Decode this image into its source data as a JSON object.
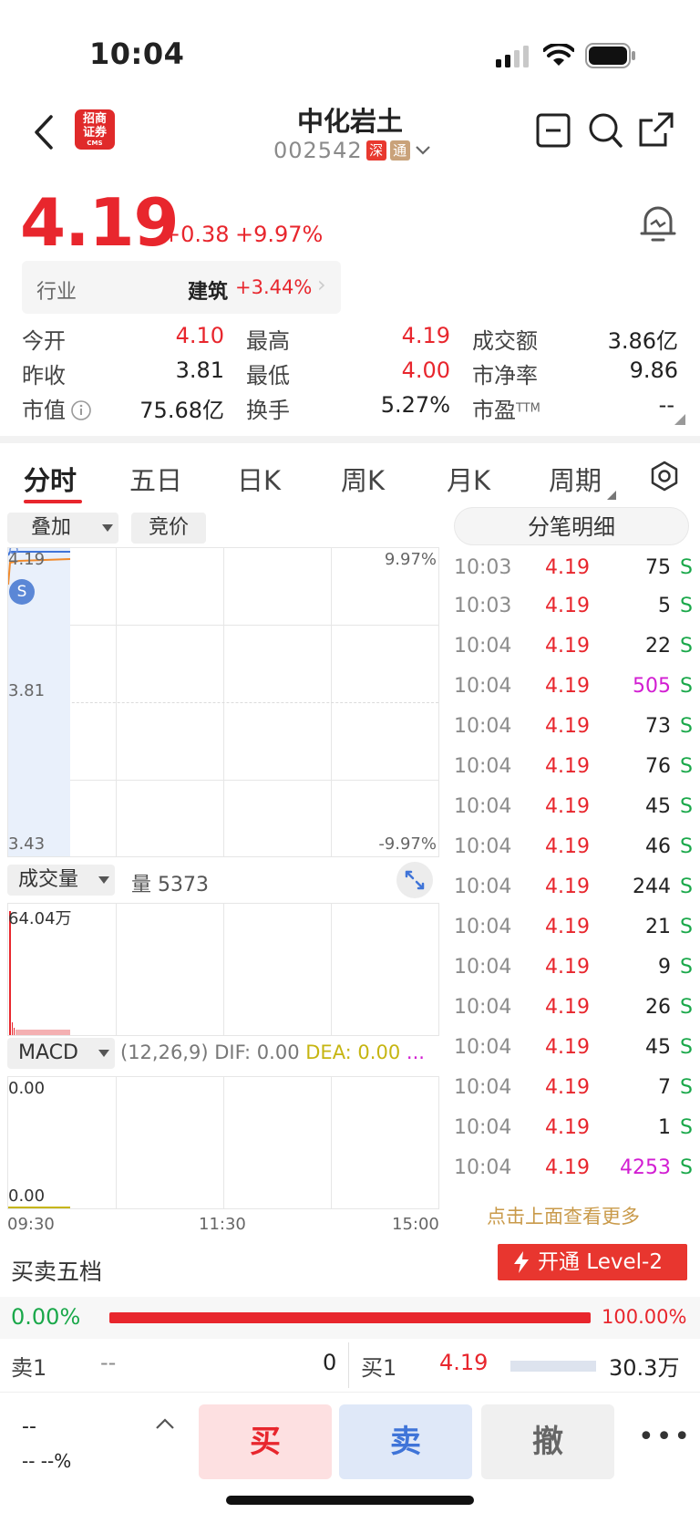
{
  "status_bar": {
    "time": "10:04"
  },
  "header": {
    "broker_logo_text": "招商证券",
    "broker_logo_sub": "CMS",
    "stock_name": "中化岩土",
    "stock_code": "002542",
    "tag_shen": "深",
    "tag_tong": "通"
  },
  "quote": {
    "price": "4.19",
    "change": "+0.38",
    "change_pct": "+9.97%",
    "industry_label": "行业",
    "industry_name": "建筑",
    "industry_pct": "+3.44%"
  },
  "stats": [
    {
      "label": "今开",
      "value": "4.10",
      "color": "#e8262d"
    },
    {
      "label": "最高",
      "value": "4.19",
      "color": "#e8262d"
    },
    {
      "label": "成交额",
      "value": "3.86亿",
      "color": "#222222"
    },
    {
      "label": "昨收",
      "value": "3.81",
      "color": "#222222"
    },
    {
      "label": "最低",
      "value": "4.00",
      "color": "#e8262d"
    },
    {
      "label": "市净率",
      "value": "9.86",
      "color": "#222222"
    },
    {
      "label": "市值",
      "value": "75.68亿",
      "color": "#222222"
    },
    {
      "label": "换手",
      "value": "5.27%",
      "color": "#222222"
    },
    {
      "label": "市盈",
      "value": "--",
      "color": "#222222",
      "sup": "TTM"
    }
  ],
  "tabs": [
    "分时",
    "五日",
    "日K",
    "周K",
    "月K",
    "周期"
  ],
  "chart": {
    "overlay_label": "叠加",
    "auction_label": "竞价",
    "price_high": "4.19",
    "price_mid": "3.81",
    "price_low": "3.43",
    "pct_high": "9.97%",
    "pct_low": "-9.97%",
    "marker": "S",
    "volume_label": "成交量",
    "volume_text": "量 5373",
    "volume_max": "64.04万",
    "macd_label": "MACD",
    "macd_params": "(12,26,9)",
    "dif": "DIF: 0.00",
    "dea": "DEA: 0.00",
    "macd_more": "...",
    "macd_top": "0.00",
    "macd_bottom": "0.00",
    "time_start": "09:30",
    "time_mid": "11:30",
    "time_end": "15:00"
  },
  "ticks_header": "分笔明细",
  "ticks": [
    {
      "time": "10:03",
      "price": "4.19",
      "vol": "75",
      "side": "S",
      "color": "#222222"
    },
    {
      "time": "10:03",
      "price": "4.19",
      "vol": "5",
      "side": "S",
      "color": "#222222"
    },
    {
      "time": "10:04",
      "price": "4.19",
      "vol": "22",
      "side": "S",
      "color": "#222222"
    },
    {
      "time": "10:04",
      "price": "4.19",
      "vol": "505",
      "side": "S",
      "color": "#d21ed2"
    },
    {
      "time": "10:04",
      "price": "4.19",
      "vol": "73",
      "side": "S",
      "color": "#222222"
    },
    {
      "time": "10:04",
      "price": "4.19",
      "vol": "76",
      "side": "S",
      "color": "#222222"
    },
    {
      "time": "10:04",
      "price": "4.19",
      "vol": "45",
      "side": "S",
      "color": "#222222"
    },
    {
      "time": "10:04",
      "price": "4.19",
      "vol": "46",
      "side": "S",
      "color": "#222222"
    },
    {
      "time": "10:04",
      "price": "4.19",
      "vol": "244",
      "side": "S",
      "color": "#222222"
    },
    {
      "time": "10:04",
      "price": "4.19",
      "vol": "21",
      "side": "S",
      "color": "#222222"
    },
    {
      "time": "10:04",
      "price": "4.19",
      "vol": "9",
      "side": "S",
      "color": "#222222"
    },
    {
      "time": "10:04",
      "price": "4.19",
      "vol": "26",
      "side": "S",
      "color": "#222222"
    },
    {
      "time": "10:04",
      "price": "4.19",
      "vol": "45",
      "side": "S",
      "color": "#222222"
    },
    {
      "time": "10:04",
      "price": "4.19",
      "vol": "7",
      "side": "S",
      "color": "#222222"
    },
    {
      "time": "10:04",
      "price": "4.19",
      "vol": "1",
      "side": "S",
      "color": "#222222"
    },
    {
      "time": "10:04",
      "price": "4.19",
      "vol": "4253",
      "side": "S",
      "color": "#d21ed2"
    }
  ],
  "more_link": "点击上面查看更多",
  "order_book": {
    "title": "买卖五档",
    "level2_btn": "开通 Level-2",
    "ratio_left": "0.00%",
    "ratio_right": "100.00%",
    "sell1_label": "卖1",
    "sell1_price": "--",
    "sell1_vol": "0",
    "buy1_label": "买1",
    "buy1_price": "4.19",
    "buy1_vol": "30.3万"
  },
  "bottom": {
    "position_value": "--",
    "position_sub": "-- --%",
    "buy": "买",
    "sell": "卖",
    "cancel": "撤",
    "more": "•••"
  }
}
